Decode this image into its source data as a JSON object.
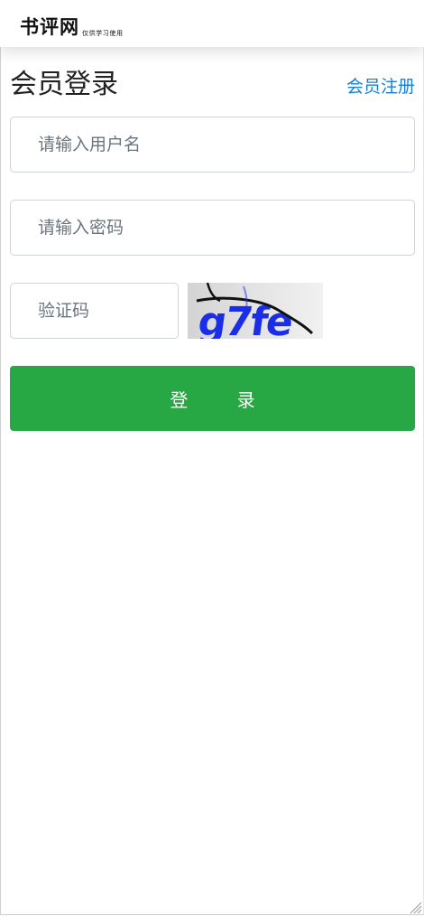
{
  "header": {
    "logo_text": "书评网",
    "logo_subtitle": "仅供学习使用"
  },
  "page": {
    "title": "会员登录",
    "register_link": "会员注册"
  },
  "form": {
    "username_placeholder": "请输入用户名",
    "password_placeholder": "请输入密码",
    "captcha_placeholder": "验证码",
    "captcha_text": "g7fe",
    "login_button": "登 录"
  },
  "colors": {
    "accent_link": "#1a7fd4",
    "button_green": "#28a745",
    "captcha_text_blue": "#1a2ee8"
  }
}
